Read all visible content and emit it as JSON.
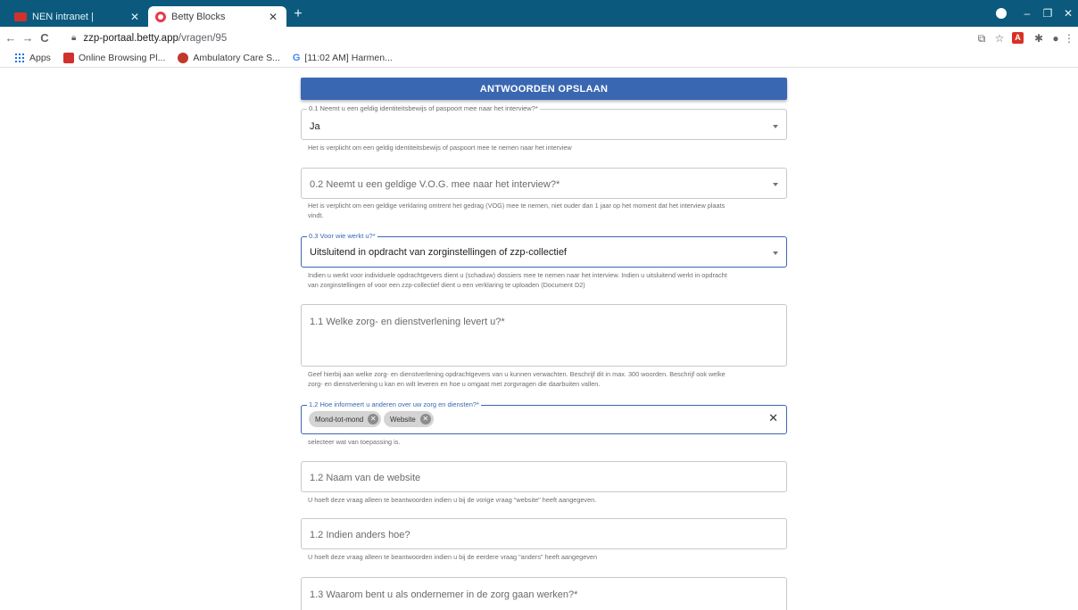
{
  "browser": {
    "tabs": [
      {
        "label": "NEN intranet |",
        "close": "✕"
      },
      {
        "label": "Betty Blocks",
        "close": "✕"
      }
    ],
    "new_tab": "+",
    "window_controls": {
      "minimize": "–",
      "maximize": "❐",
      "close": "✕"
    },
    "nav": {
      "back": "←",
      "forward": "→",
      "reload": "C"
    },
    "url": {
      "host": "zzp-portaal.betty.app",
      "path": "/vragen/95"
    },
    "toolbar_icons": [
      "translate-icon",
      "star-icon",
      "pdf-icon",
      "extensions-icon",
      "profile-icon",
      "menu-icon"
    ],
    "bookmarks": [
      {
        "label": "Apps"
      },
      {
        "label": "Online Browsing Pl..."
      },
      {
        "label": "Ambulatory Care S..."
      },
      {
        "label": "[11:02 AM] Harmen..."
      }
    ]
  },
  "form": {
    "save_label": "ANTWOORDEN OPSLAAN",
    "q01": {
      "label": "0.1 Neemt u een geldig identiteitsbewijs of paspoort mee naar het interview?*",
      "value": "Ja",
      "helper": "Het is verplicht om een geldig identiteitsbewijs of paspoort mee te nemen naar het interview"
    },
    "q02": {
      "placeholder": "0.2 Neemt u een geldige V.O.G. mee naar het interview?*",
      "helper_line1": "Het is verplicht om een geldige verklaring omtrent het gedrag (VOG) mee te nemen, niet ouder dan 1 jaar op het moment dat het interview plaats",
      "helper_line2": "vindt."
    },
    "q03": {
      "label": "0.3 Voor wie werkt u?*",
      "value": "Uitsluitend in opdracht van zorginstellingen of zzp-collectief",
      "helper_line1": "Indien u werkt voor individuele opdrachtgevers dient u (schaduw) dossiers mee te nemen naar het interview. Indien u uitsluitend werkt in opdracht",
      "helper_line2": "van zorginstellingen of voor een zzp-collectief dient u een verklaring te uploaden (Document D2)"
    },
    "q11": {
      "placeholder": "1.1 Welke zorg- en dienstverlening levert u?*",
      "helper_line1": "Geef hierbij aan welke zorg- en dienstverlening opdrachtgevers van u kunnen verwachten. Beschrijf dit in max. 300 woorden. Beschrijf ook welke",
      "helper_line2": "zorg- en dienstverlening u kan en wilt leveren en hoe u omgaat met zorgvragen die daarbuiten vallen."
    },
    "q12": {
      "label": "1.2 Hoe informeert u anderen over uw zorg en diensten?*",
      "chips": [
        "Mond-tot-mond",
        "Website"
      ],
      "clear": "✕",
      "helper": "selecteer wat van toepassing is."
    },
    "q12_website": {
      "placeholder": "1.2 Naam van de website",
      "helper": "U hoeft deze vraag alleen te beantwoorden indien u bij de vorige vraag \"website\" heeft aangegeven."
    },
    "q12_anders": {
      "placeholder": "1.2 Indien anders hoe?",
      "helper": "U hoeft deze vraag alleen te beantwoorden indien u bij de eerdere vraag \"anders\" heeft aangegeven"
    },
    "q13": {
      "placeholder": "1.3 Waarom bent u als ondernemer in de zorg gaan werken?*"
    }
  }
}
